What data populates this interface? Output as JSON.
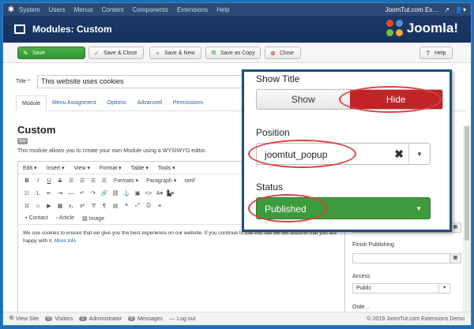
{
  "topbar": {
    "menu": [
      "System",
      "Users",
      "Menus",
      "Content",
      "Components",
      "Extensions",
      "Help"
    ],
    "site_name": "JoomTut.com Ex…"
  },
  "titlebar": {
    "title": "Modules: Custom",
    "brand": "Joomla!"
  },
  "toolbar": {
    "save": "Save",
    "save_close": "Save & Close",
    "save_new": "Save & New",
    "save_copy": "Save as Copy",
    "close": "Close",
    "help": "Help"
  },
  "form": {
    "title_label": "Title *",
    "title_value": "This website uses cookies",
    "tabs": [
      "Module",
      "Menu Assignment",
      "Options",
      "Advanced",
      "Permissions"
    ],
    "module_heading": "Custom",
    "site_badge": "Site",
    "description": "This module allows you to create your own Module using a WYSIWYG editor."
  },
  "editor": {
    "menus": [
      "Edit",
      "Insert",
      "View",
      "Format",
      "Table",
      "Tools"
    ],
    "formats_label": "Formats",
    "paragraph_label": "Paragraph",
    "font_label": "serif",
    "btn_contact": "Contact",
    "btn_article": "Article",
    "btn_image": "Image",
    "content_text": "We use cookies to ensure that we give you the best experience on our website. If you continue to use this site we will assume that you are happy with it.",
    "content_link": "More Info"
  },
  "sidebar": {
    "finish_publishing_label": "Finish Publishing",
    "access_label": "Access",
    "access_value": "Public",
    "ordering_label": "Orde…"
  },
  "statusbar": {
    "view_site": "View Site",
    "visitors_count": "0",
    "visitors_label": "Visitors",
    "admin_count": "1",
    "admin_label": "Administrator",
    "messages_count": "0",
    "messages_label": "Messages",
    "logout": "Log out",
    "copyright": "© 2019 JoomTut.com Extensions Demo"
  },
  "callout": {
    "show_title_label": "Show Title",
    "show_option": "Show",
    "hide_option": "Hide",
    "position_label": "Position",
    "position_value": "joomtut_popup",
    "status_label": "Status",
    "status_value": "Published"
  },
  "colors": {
    "header_bg": "#1a3867",
    "save_green": "#3aa23a",
    "hide_red": "#c12327",
    "published_green": "#3d9a3d",
    "highlight_ring": "#d9423f",
    "link_blue": "#1e63b0"
  }
}
